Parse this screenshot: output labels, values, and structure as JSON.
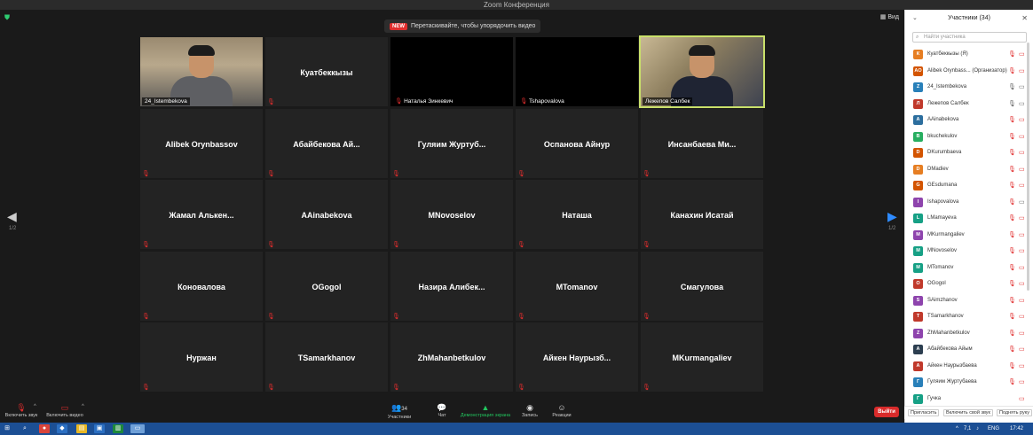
{
  "window": {
    "title": "Zoom Конференция"
  },
  "banner": {
    "badge": "NEW",
    "text": "Перетаскивайте, чтобы упорядочить видео"
  },
  "view_button": {
    "label": "Вид"
  },
  "grid": {
    "page_left": "1/2",
    "page_right": "1/2",
    "tiles": [
      {
        "name": "",
        "label": "24_Istembekova",
        "kind": "video1"
      },
      {
        "name": "Куатбеккызы",
        "label": "",
        "kind": "name"
      },
      {
        "name": "",
        "label": "Наталья Зинкевич",
        "kind": "black"
      },
      {
        "name": "",
        "label": "Tshapovalova",
        "kind": "black"
      },
      {
        "name": "",
        "label": "Лежепов Салбек",
        "kind": "video2"
      },
      {
        "name": "Alibek Orynbassov",
        "label": "",
        "kind": "name"
      },
      {
        "name": "Абайбекова  Ай...",
        "label": "",
        "kind": "name"
      },
      {
        "name": "Гуляим  Журтуб...",
        "label": "",
        "kind": "name"
      },
      {
        "name": "Оспанова Айнур",
        "label": "",
        "kind": "name"
      },
      {
        "name": "Инсанбаева  Ми...",
        "label": "",
        "kind": "name"
      },
      {
        "name": "Жамал  Алькен...",
        "label": "",
        "kind": "name"
      },
      {
        "name": "AAinabekova",
        "label": "",
        "kind": "name"
      },
      {
        "name": "MNovoselov",
        "label": "",
        "kind": "name"
      },
      {
        "name": "Наташа",
        "label": "",
        "kind": "name"
      },
      {
        "name": "Канахин Исатай",
        "label": "",
        "kind": "name"
      },
      {
        "name": "Коновалова",
        "label": "",
        "kind": "name"
      },
      {
        "name": "OGogol",
        "label": "",
        "kind": "name"
      },
      {
        "name": "Назира  Алибек...",
        "label": "",
        "kind": "name"
      },
      {
        "name": "MTomanov",
        "label": "",
        "kind": "name"
      },
      {
        "name": "Смагулова",
        "label": "",
        "kind": "name"
      },
      {
        "name": "Нуржан",
        "label": "",
        "kind": "name"
      },
      {
        "name": "TSamarkhanov",
        "label": "",
        "kind": "name"
      },
      {
        "name": "ZhMahanbetkulov",
        "label": "",
        "kind": "name"
      },
      {
        "name": "Айкен  Наурызб...",
        "label": "",
        "kind": "name"
      },
      {
        "name": "MKurmangaliev",
        "label": "",
        "kind": "name"
      }
    ]
  },
  "toolbar": {
    "mic_label": "Включить звук",
    "video_label": "Включить видео",
    "participants_label": "Участники",
    "participants_count": "34",
    "chat_label": "Чат",
    "share_label": "Демонстрация экрана",
    "record_label": "Запись",
    "reactions_label": "Реакции",
    "leave_label": "Выйти"
  },
  "panel": {
    "title": "Участники (34)",
    "search_placeholder": "Найти участника",
    "participants": [
      {
        "initial": "К",
        "name": "Куатбеккызы (Я)",
        "color": "#e67e22",
        "mic": "off",
        "video": "off"
      },
      {
        "initial": "AO",
        "name": "Alibek Orynbass... (Организатор)",
        "color": "#d35400",
        "mic": "off",
        "video": "off"
      },
      {
        "initial": "Z",
        "name": "24_Istembekova",
        "color": "#2980b9",
        "mic": "on",
        "video": "on"
      },
      {
        "initial": "Л",
        "name": "Лежепов Салбек",
        "color": "#c0392b",
        "mic": "on",
        "video": "on"
      },
      {
        "initial": "A",
        "name": "AAinabekova",
        "color": "#2c6e9e",
        "mic": "off",
        "video": "off"
      },
      {
        "initial": "В",
        "name": "bkuchekulov",
        "color": "#27ae60",
        "mic": "off",
        "video": "off"
      },
      {
        "initial": "D",
        "name": "DKurumbaeva",
        "color": "#d35400",
        "mic": "off",
        "video": "off"
      },
      {
        "initial": "D",
        "name": "DMadiev",
        "color": "#e67e22",
        "mic": "off",
        "video": "off"
      },
      {
        "initial": "G",
        "name": "GEsdumana",
        "color": "#d35400",
        "mic": "off",
        "video": "off"
      },
      {
        "initial": "I",
        "name": "Ishapovalova",
        "color": "#8e44ad",
        "mic": "off",
        "video": "on"
      },
      {
        "initial": "L",
        "name": "LMamayeva",
        "color": "#16a085",
        "mic": "off",
        "video": "off"
      },
      {
        "initial": "M",
        "name": "MKurmangaliev",
        "color": "#8e44ad",
        "mic": "off",
        "video": "off"
      },
      {
        "initial": "M",
        "name": "MNovoselov",
        "color": "#16a085",
        "mic": "off",
        "video": "off"
      },
      {
        "initial": "M",
        "name": "MTomanov",
        "color": "#16a085",
        "mic": "off",
        "video": "off"
      },
      {
        "initial": "O",
        "name": "OGogol",
        "color": "#c0392b",
        "mic": "off",
        "video": "off"
      },
      {
        "initial": "S",
        "name": "SAimzhanov",
        "color": "#8e44ad",
        "mic": "off",
        "video": "off"
      },
      {
        "initial": "T",
        "name": "TSamarkhanov",
        "color": "#c0392b",
        "mic": "off",
        "video": "off"
      },
      {
        "initial": "Z",
        "name": "ZhMahanbetkulov",
        "color": "#8e44ad",
        "mic": "off",
        "video": "off"
      },
      {
        "initial": "A",
        "name": "Абайбекова Айым",
        "color": "#2c3e50",
        "mic": "off",
        "video": "off"
      },
      {
        "initial": "A",
        "name": "Айкен Наурызбаева",
        "color": "#c0392b",
        "mic": "off",
        "video": "off"
      },
      {
        "initial": "Г",
        "name": "Гуляим Журтубаева",
        "color": "#2980b9",
        "mic": "off",
        "video": "off"
      },
      {
        "initial": "Г",
        "name": "Гучка",
        "color": "#16a085",
        "mic": "none",
        "video": "off"
      }
    ],
    "footer": {
      "invite": "Пригласить",
      "unmute_me": "Включить свой звук",
      "raise_hand": "Поднять руку"
    }
  },
  "taskbar": {
    "lang": "ENG",
    "time": "17:42",
    "num": "7,1"
  }
}
